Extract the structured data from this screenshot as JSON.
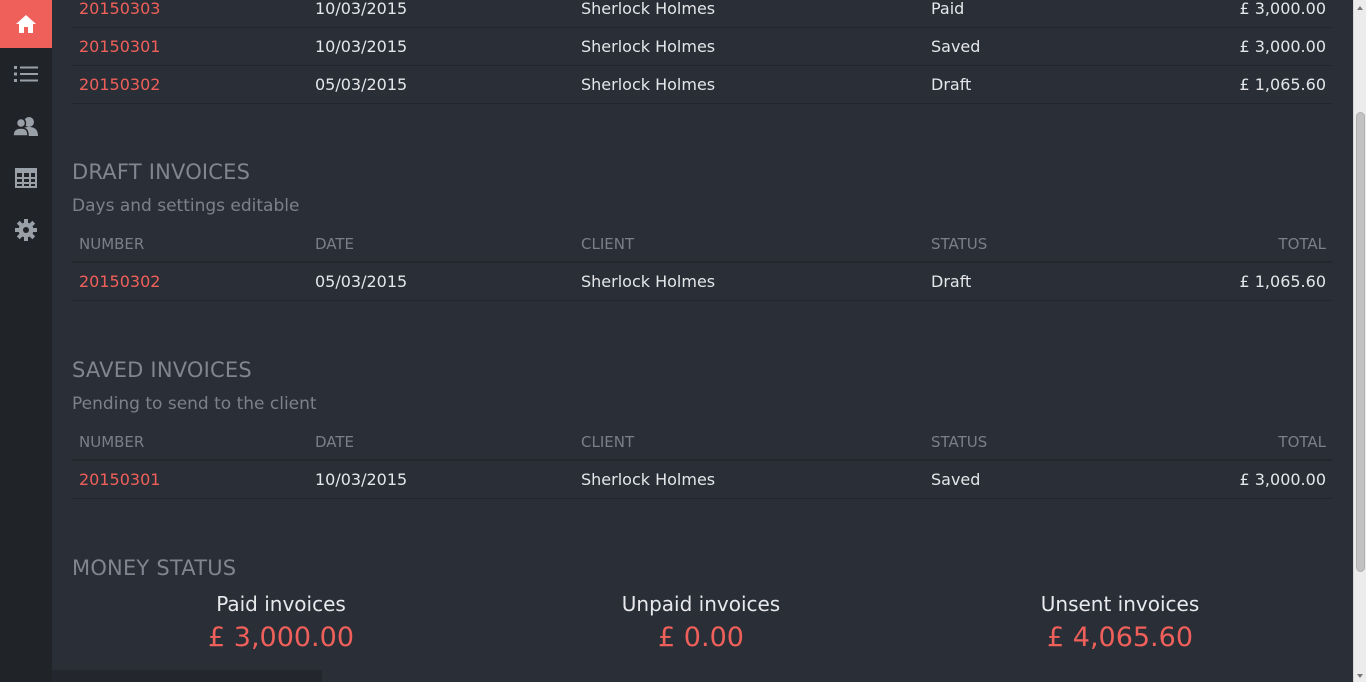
{
  "sidebar": {
    "items": [
      {
        "icon": "home-icon",
        "active": true
      },
      {
        "icon": "list-icon"
      },
      {
        "icon": "users-icon"
      },
      {
        "icon": "calendar-icon"
      },
      {
        "icon": "gear-icon"
      }
    ]
  },
  "all_invoices": {
    "rows": [
      {
        "number": "20150303",
        "date": "10/03/2015",
        "client": "Sherlock Holmes",
        "status": "Paid",
        "total": "£ 3,000.00"
      },
      {
        "number": "20150301",
        "date": "10/03/2015",
        "client": "Sherlock Holmes",
        "status": "Saved",
        "total": "£ 3,000.00"
      },
      {
        "number": "20150302",
        "date": "05/03/2015",
        "client": "Sherlock Holmes",
        "status": "Draft",
        "total": "£ 1,065.60"
      }
    ]
  },
  "columns": {
    "number": "NUMBER",
    "date": "DATE",
    "client": "CLIENT",
    "status": "STATUS",
    "total": "TOTAL"
  },
  "draft": {
    "title": "DRAFT INVOICES",
    "subtitle": "Days and settings editable",
    "rows": [
      {
        "number": "20150302",
        "date": "05/03/2015",
        "client": "Sherlock Holmes",
        "status": "Draft",
        "total": "£ 1,065.60"
      }
    ]
  },
  "saved": {
    "title": "SAVED INVOICES",
    "subtitle": "Pending to send to the client",
    "rows": [
      {
        "number": "20150301",
        "date": "10/03/2015",
        "client": "Sherlock Holmes",
        "status": "Saved",
        "total": "£ 3,000.00"
      }
    ]
  },
  "money": {
    "title": "MONEY STATUS",
    "paid": {
      "label": "Paid invoices",
      "amount": "£ 3,000.00"
    },
    "unpaid": {
      "label": "Unpaid invoices",
      "amount": "£ 0.00"
    },
    "unsent": {
      "label": "Unsent invoices",
      "amount": "£ 4,065.60"
    }
  },
  "colors": {
    "accent": "#f0605a",
    "background": "#2a2e37",
    "sidebar": "#202328"
  }
}
